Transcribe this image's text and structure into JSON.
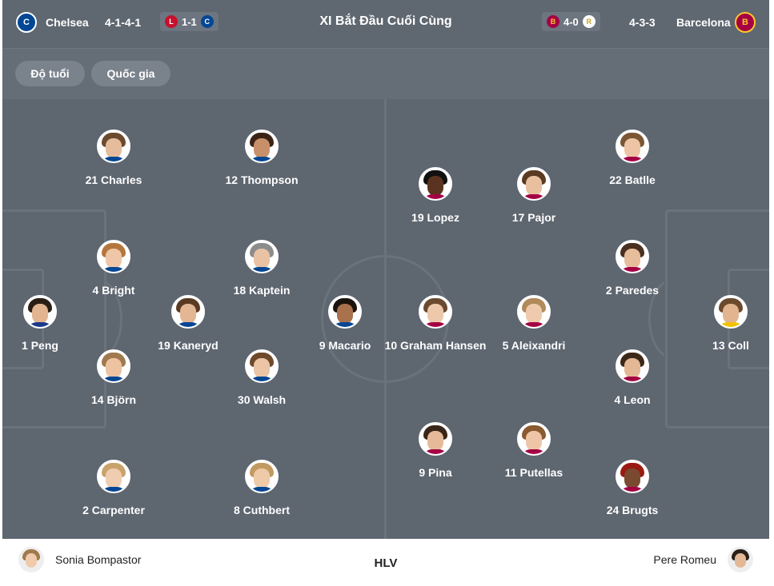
{
  "header": {
    "title": "XI Bắt Đầu Cuối Cùng",
    "home": {
      "name": "Chelsea",
      "formation": "4-1-4-1",
      "last_result": "1-1",
      "badge_color": "#034694"
    },
    "away": {
      "name": "Barcelona",
      "formation": "4-3-3",
      "last_result": "4-0",
      "badge_color": "#a50044"
    }
  },
  "filters": {
    "age_label": "Độ tuổi",
    "country_label": "Quốc gia"
  },
  "home_players": [
    {
      "label": "1 Peng"
    },
    {
      "label": "21 Charles"
    },
    {
      "label": "4 Bright"
    },
    {
      "label": "14 Björn"
    },
    {
      "label": "2 Carpenter"
    },
    {
      "label": "19 Kaneryd"
    },
    {
      "label": "12 Thompson"
    },
    {
      "label": "18 Kaptein"
    },
    {
      "label": "30 Walsh"
    },
    {
      "label": "8 Cuthbert"
    },
    {
      "label": "9 Macario"
    }
  ],
  "away_players": [
    {
      "label": "13 Coll"
    },
    {
      "label": "22 Batlle"
    },
    {
      "label": "2 Paredes"
    },
    {
      "label": "4 Leon"
    },
    {
      "label": "24 Brugts"
    },
    {
      "label": "17 Pajor"
    },
    {
      "label": "5 Aleixandri"
    },
    {
      "label": "11 Putellas"
    },
    {
      "label": "19 Lopez"
    },
    {
      "label": "10 Graham Hansen"
    },
    {
      "label": "9 Pina"
    }
  ],
  "coaches": {
    "home": "Sonia Bompastor",
    "label": "HLV",
    "away": "Pere Romeu"
  },
  "colors": {
    "pitch": "#5e6670",
    "header": "#5f6770",
    "lines": "#6a727c"
  }
}
